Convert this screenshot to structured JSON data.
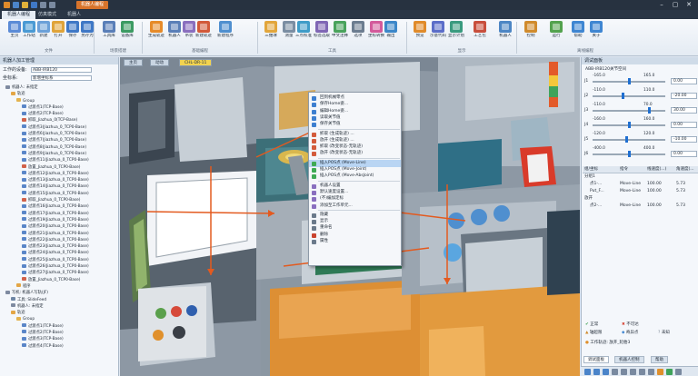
{
  "window": {
    "title": "机器人编程",
    "controls": [
      "–",
      "▢",
      "✕"
    ]
  },
  "ribbon_tabs": [
    {
      "label": "机器人编程",
      "active": true
    },
    {
      "label": "仿真模式",
      "active": false
    },
    {
      "label": "机器人",
      "active": false
    }
  ],
  "ribbon_buttons": [
    {
      "label": "主页",
      "color": "#5b8bd6"
    },
    {
      "label": "工作站",
      "color": "#4a9ad4"
    },
    {
      "label": "新建",
      "color": "#6ba0d8"
    },
    {
      "label": "打开",
      "color": "#e0a43a"
    },
    {
      "label": "保存",
      "color": "#3f78c6"
    },
    {
      "label": "另存为",
      "color": "#3f78c6"
    },
    {
      "label": "工具库",
      "color": "#5a7fb8"
    },
    {
      "label": "设备库",
      "color": "#3c9b63"
    },
    {
      "label": "生成轨迹",
      "color": "#e68b2a"
    },
    {
      "label": "机器人",
      "color": "#5a7fb8"
    },
    {
      "label": "吊装",
      "color": "#8a6fbf"
    },
    {
      "label": "新建轨迹",
      "color": "#d25a3a"
    },
    {
      "label": "新建程序",
      "color": "#4f8fcf"
    },
    {
      "label": "三维球",
      "color": "#e2a63c"
    },
    {
      "label": "测量",
      "color": "#7b8ea3"
    },
    {
      "label": "三点校准",
      "color": "#3f9cc8"
    },
    {
      "label": "标签选取",
      "color": "#8067b5"
    },
    {
      "label": "中文注释",
      "color": "#4aa35d"
    },
    {
      "label": "选项",
      "color": "#6c7d90"
    },
    {
      "label": "坐标转换",
      "color": "#d35a9b"
    },
    {
      "label": "输出",
      "color": "#3c87c9"
    },
    {
      "label": "预览",
      "color": "#e08b2b"
    },
    {
      "label": "示意代码",
      "color": "#5c6ec9"
    },
    {
      "label": "显示计划",
      "color": "#3a9b7f"
    },
    {
      "label": "工艺包",
      "color": "#c84f3d"
    },
    {
      "label": "机器人",
      "color": "#4d86c4"
    },
    {
      "label": "控制",
      "color": "#d08b2d"
    },
    {
      "label": "运行",
      "color": "#53a24e"
    },
    {
      "label": "帮助",
      "color": "#3f86d2"
    },
    {
      "label": "关于",
      "color": "#3f86d2"
    }
  ],
  "ribbon_groups": [
    "文件",
    "场景搭建",
    "基础编程",
    "工具",
    "显示",
    "离线编程"
  ],
  "left_panel": {
    "header": "机器人加工管理",
    "fields": [
      {
        "label": "工作的设备:",
        "value": "ABB-IRB120"
      },
      {
        "label": "坐标系:",
        "value": "新增坐标系"
      }
    ],
    "tree": [
      {
        "indent": 6,
        "text": "机器人: 未指定",
        "icon": "#7e8aa0"
      },
      {
        "indent": 12,
        "text": "轨迹",
        "icon": "#e3a646"
      },
      {
        "indent": 18,
        "text": "Group",
        "icon": "#e3b34f"
      },
      {
        "indent": 24,
        "text": "过渡点1(TCP-Base)",
        "icon": "#5a86c8"
      },
      {
        "indent": 24,
        "text": "过渡点2(TCP-Base)",
        "icon": "#5a86c8"
      },
      {
        "indent": 24,
        "text": "抓取_Jiazhua_0(TCP-Base)",
        "icon": "#d1624a"
      },
      {
        "indent": 24,
        "text": "过渡点3(Jiazhua_0_TCP0-Base)",
        "icon": "#5a86c8"
      },
      {
        "indent": 24,
        "text": "过渡点6(Jiazhua_0_TCP0-Base)",
        "icon": "#5a86c8"
      },
      {
        "indent": 24,
        "text": "过渡点7(Jiazhua_0_TCP0-Base)",
        "icon": "#5a86c8"
      },
      {
        "indent": 24,
        "text": "过渡点8(Jiazhua_0_TCP0-Base)",
        "icon": "#5a86c8"
      },
      {
        "indent": 24,
        "text": "过渡点9(Jiazhua_0_TCP0-Base)",
        "icon": "#5a86c8"
      },
      {
        "indent": 24,
        "text": "过渡点11(Jiazhua_0_TCP0-Base)",
        "icon": "#5a86c8"
      },
      {
        "indent": 24,
        "text": "放置_Jiazhua_0_TCP0-Base)",
        "icon": "#d1624a"
      },
      {
        "indent": 24,
        "text": "过渡点12(Jiazhua_0_TCP0-Base)",
        "icon": "#5a86c8"
      },
      {
        "indent": 24,
        "text": "过渡点13(Jiazhua_0_TCP0-Base)",
        "icon": "#5a86c8"
      },
      {
        "indent": 24,
        "text": "过渡点14(Jiazhua_0_TCP0-Base)",
        "icon": "#5a86c8"
      },
      {
        "indent": 24,
        "text": "过渡点15(Jiazhua_0_TCP0-Base)",
        "icon": "#5a86c8"
      },
      {
        "indent": 24,
        "text": "抓取_Jiazhua_0_TCP0-Base)",
        "icon": "#d1624a"
      },
      {
        "indent": 24,
        "text": "过渡点16(Jiazhua_0_TCP0-Base)",
        "icon": "#5a86c8"
      },
      {
        "indent": 24,
        "text": "过渡点17(Jiazhua_0_TCP0-Base)",
        "icon": "#5a86c8"
      },
      {
        "indent": 24,
        "text": "过渡点19(Jiazhua_0_TCP0-Base)",
        "icon": "#5a86c8"
      },
      {
        "indent": 24,
        "text": "过渡点20(Jiazhua_0_TCP0-Base)",
        "icon": "#5a86c8"
      },
      {
        "indent": 24,
        "text": "过渡点21(Jiazhua_0_TCP0-Base)",
        "icon": "#5a86c8"
      },
      {
        "indent": 24,
        "text": "过渡点22(Jiazhua_0_TCP0-Base)",
        "icon": "#5a86c8"
      },
      {
        "indent": 24,
        "text": "过渡点23(Jiazhua_0_TCP0-Base)",
        "icon": "#5a86c8"
      },
      {
        "indent": 24,
        "text": "过渡点24(Jiazhua_0_TCP0-Base)",
        "icon": "#5a86c8"
      },
      {
        "indent": 24,
        "text": "过渡点25(Jiazhua_0_TCP0-Base)",
        "icon": "#5a86c8"
      },
      {
        "indent": 24,
        "text": "过渡点26(Jiazhua_0_TCP0-Base)",
        "icon": "#5a86c8"
      },
      {
        "indent": 24,
        "text": "过渡点27(Jiazhua_0_TCP0-Base)",
        "icon": "#5a86c8"
      },
      {
        "indent": 24,
        "text": "放置_Jiazhua_0_TCP0-Base)",
        "icon": "#d1624a"
      },
      {
        "indent": 18,
        "text": "程序",
        "icon": "#e3a646"
      },
      {
        "indent": 6,
        "text": "写机: 机器人写轨(JF)",
        "icon": "#7e8aa0"
      },
      {
        "indent": 12,
        "text": "工具: SlideFeed",
        "icon": "#6f87a5"
      },
      {
        "indent": 12,
        "text": "机器人: 未指定",
        "icon": "#7e8aa0"
      },
      {
        "indent": 12,
        "text": "轨迹",
        "icon": "#e3a646"
      },
      {
        "indent": 18,
        "text": "Group",
        "icon": "#e3b34f"
      },
      {
        "indent": 24,
        "text": "过渡点1(TCP-Base)",
        "icon": "#5a86c8"
      },
      {
        "indent": 24,
        "text": "过渡点2(TCP-Base)",
        "icon": "#5a86c8"
      },
      {
        "indent": 24,
        "text": "过渡点3(TCP-Base)",
        "icon": "#5a86c8"
      },
      {
        "indent": 24,
        "text": "过渡点4(TCP-Base)",
        "icon": "#5a86c8"
      }
    ]
  },
  "scene_tabs": [
    {
      "label": "主页",
      "active": false
    },
    {
      "label": "动动",
      "active": false
    },
    {
      "label": "CHL-DR-11",
      "active": true
    }
  ],
  "context_menu": [
    {
      "label": "回到机械零点",
      "icon": "#3d7fd0",
      "highlight": false
    },
    {
      "label": "保存Home姿...",
      "icon": "#3d7fd0",
      "highlight": false
    },
    {
      "label": "编辑Home姿...",
      "icon": "#3d7fd0",
      "highlight": false
    },
    {
      "label": "读取关节值",
      "icon": "#3d7fd0",
      "highlight": false
    },
    {
      "label": "保存关节值",
      "icon": "#3d7fd0",
      "highlight": false
    },
    {
      "sep": true
    },
    {
      "label": "抓取 (生成轨迹) ...",
      "icon": "#d35b3b",
      "highlight": false
    },
    {
      "label": "放开 (生成轨迹) ...",
      "icon": "#d35b3b",
      "highlight": false
    },
    {
      "label": "抓取 (改变状态-无轨迹)",
      "icon": "#d35b3b",
      "highlight": false
    },
    {
      "label": "放开 (改变状态-无轨迹)",
      "icon": "#d35b3b",
      "highlight": false
    },
    {
      "sep": true
    },
    {
      "label": "插入POS点 (Move-Line)",
      "icon": "#3faa55",
      "highlight": true
    },
    {
      "label": "插入POS点 (Move-Joint)",
      "icon": "#3faa55",
      "highlight": false
    },
    {
      "label": "插入POS点 (Move-AbsJoint)",
      "icon": "#3faa55",
      "highlight": false
    },
    {
      "sep": true
    },
    {
      "label": "机器人设置",
      "icon": "#8a6fbf",
      "highlight": false
    },
    {
      "label": "默认速度设置...",
      "icon": "#8a6fbf",
      "highlight": false
    },
    {
      "label": "(不)编加定标",
      "icon": "#8a6fbf",
      "highlight": false
    },
    {
      "label": "添加至工作单元...",
      "icon": "#8a6fbf",
      "highlight": false
    },
    {
      "sep": true
    },
    {
      "label": "隐藏",
      "icon": "#6b7a8b",
      "highlight": false
    },
    {
      "label": "显示",
      "icon": "#6b7a8b",
      "highlight": false
    },
    {
      "label": "重命名",
      "icon": "#6b7a8b",
      "highlight": false
    },
    {
      "label": "删除",
      "icon": "#c9442f",
      "highlight": false
    },
    {
      "label": "属性",
      "icon": "#6b7a8b",
      "highlight": false
    }
  ],
  "right_panel": {
    "header": "调试面板",
    "robot": "ABB-IRB120关节空间",
    "joints": [
      {
        "name": "J1",
        "min": "-165.0",
        "max": "165.0",
        "value": "0.00",
        "pos": 0.5
      },
      {
        "name": "J2",
        "min": "-110.0",
        "max": "110.0",
        "value": "-20.00",
        "pos": 0.41
      },
      {
        "name": "J3",
        "min": "-110.0",
        "max": "70.0",
        "value": "30.00",
        "pos": 0.78
      },
      {
        "name": "J4",
        "min": "-160.0",
        "max": "160.0",
        "value": "0.00",
        "pos": 0.5
      },
      {
        "name": "J5",
        "min": "-120.0",
        "max": "120.0",
        "value": "-10.00",
        "pos": 0.46
      },
      {
        "name": "J6",
        "min": "-400.0",
        "max": "400.0",
        "value": "0.00",
        "pos": 0.5
      }
    ],
    "table_headers": [
      "组/坐标",
      "指令",
      "线速度(...)",
      "角速度(..."
    ],
    "table_rows": [
      {
        "name": "分组1",
        "cmd": "",
        "lin": "",
        "ang": ""
      },
      {
        "name": "点1-...",
        "cmd": "Move-Line",
        "lin": "100.00",
        "ang": "5.73"
      },
      {
        "name": "Put_F...",
        "cmd": "Move-Line",
        "lin": "100.00",
        "ang": "5.73"
      },
      {
        "name": "放开",
        "cmd": "",
        "lin": "",
        "ang": ""
      },
      {
        "name": "点2-...",
        "cmd": "Move-Line",
        "lin": "100.00",
        "ang": "5.73"
      }
    ],
    "options": [
      "正常",
      "不可达",
      "轴超限",
      "奇异点",
      "未知"
    ],
    "status_text": "工作轨迹: 放开_轮胎3",
    "bottom_tabs": [
      {
        "label": "调试面板",
        "active": true
      },
      {
        "label": "机器人控制",
        "active": false
      },
      {
        "label": "帮助",
        "active": false
      }
    ]
  }
}
